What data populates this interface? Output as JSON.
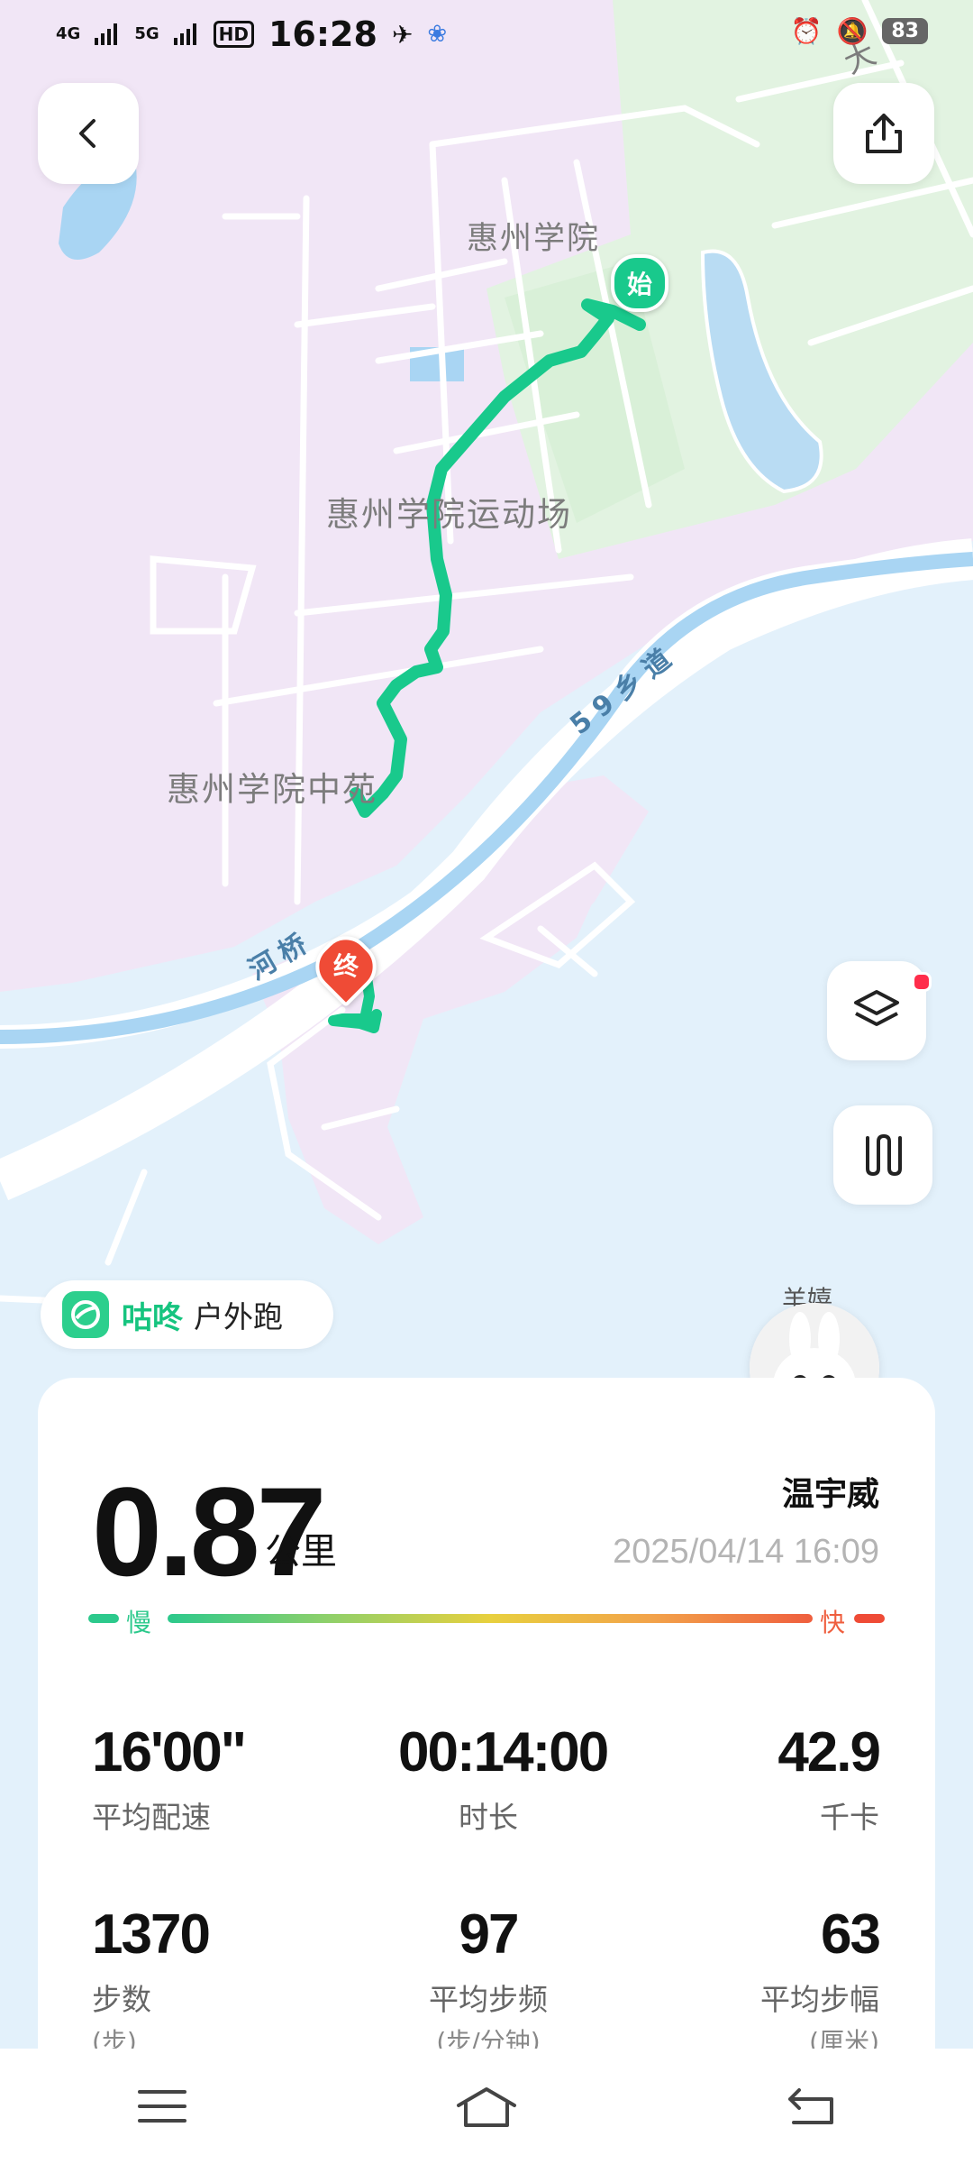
{
  "status_bar": {
    "network1": "4G",
    "network2": "5G",
    "hd": "HD",
    "time": "16:28",
    "battery": "83"
  },
  "map": {
    "labels": {
      "huizhou_college": "惠州学院",
      "stadium": "惠州学院运动场",
      "zhongyuan": "惠州学院中苑",
      "road_59": "59乡道",
      "hengqiao_rd": "河桥",
      "road_right": "大道路"
    },
    "start_marker": "始",
    "end_marker": "终"
  },
  "brand": {
    "name": "咕咚",
    "activity_type": "户外跑"
  },
  "user": {
    "nickname": "羊嬉",
    "name": "温宇威",
    "datetime": "2025/04/14 16:09"
  },
  "summary": {
    "distance": "0.87",
    "distance_unit": "公里",
    "pace_slow": "慢",
    "pace_fast": "快"
  },
  "stats": [
    {
      "value": "16'00\"",
      "label": "平均配速",
      "sub": ""
    },
    {
      "value": "00:14:00",
      "label": "时长",
      "sub": ""
    },
    {
      "value": "42.9",
      "label": "千卡",
      "sub": ""
    },
    {
      "value": "1370",
      "label": "步数",
      "sub": "(步)"
    },
    {
      "value": "97",
      "label": "平均步频",
      "sub": "(步/分钟)"
    },
    {
      "value": "63",
      "label": "平均步幅",
      "sub": "(厘米)"
    }
  ],
  "colors": {
    "brand_green": "#16c47f",
    "route_green": "#19c98c",
    "end_red": "#ef4b36"
  }
}
